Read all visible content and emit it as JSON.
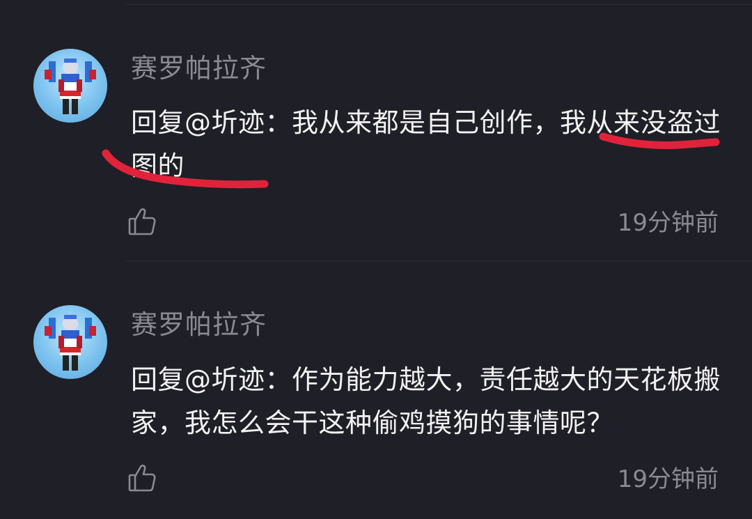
{
  "comments": [
    {
      "username": "赛罗帕拉齐",
      "body": "回复@圻迹：我从来都是自己创作，我从来没盗过图的",
      "timestamp": "19分钟前",
      "like_icon": "thumbs-up-icon"
    },
    {
      "username": "赛罗帕拉齐",
      "body": "回复@圻迹：作为能力越大，责任越大的天花板搬家，我怎么会干这种偷鸡摸狗的事情呢？",
      "timestamp": "19分钟前",
      "like_icon": "thumbs-up-icon"
    }
  ],
  "colors": {
    "background": "#1f1f27",
    "username": "#8a8a93",
    "body_text": "#f2f2f2",
    "annotation": "#e0233a"
  }
}
